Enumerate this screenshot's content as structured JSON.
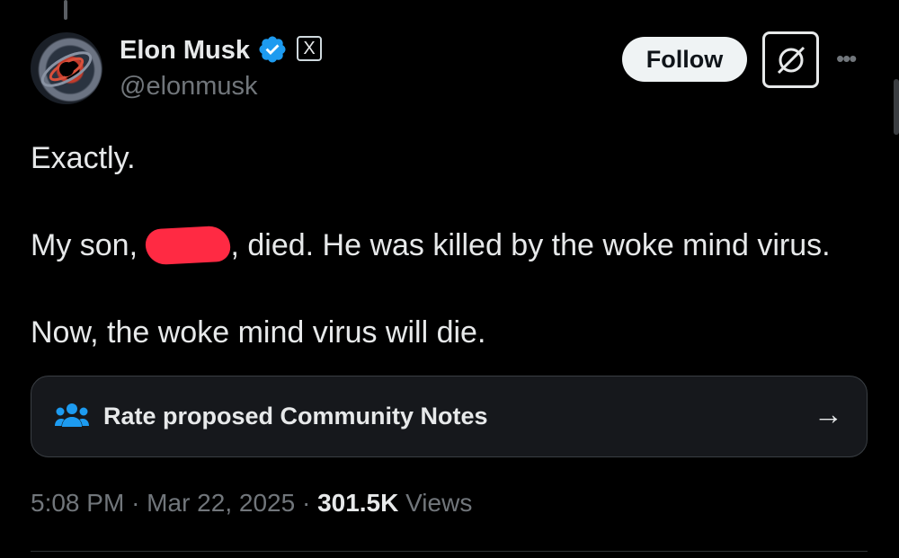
{
  "author": {
    "name": "Elon Musk",
    "handle": "@elonmusk",
    "verified": true,
    "affiliation_badge": "X"
  },
  "actions": {
    "follow_label": "Follow",
    "grok_icon": "grok-icon",
    "more_icon": "more-icon"
  },
  "tweet": {
    "line1": "Exactly.",
    "line2_before": "My son, ",
    "line2_after": ", died. He was killed by the woke mind virus.",
    "line3": "Now, the woke mind virus will die."
  },
  "community_notes": {
    "label": "Rate proposed Community Notes",
    "icon": "people-icon",
    "arrow": "→"
  },
  "meta": {
    "time": "5:08 PM",
    "sep1": "·",
    "date": "Mar 22, 2025",
    "sep2": "·",
    "views_count": "301.5K",
    "views_label": "Views"
  },
  "colors": {
    "background": "#000000",
    "text": "#e7e9ea",
    "secondary_text": "#71767b",
    "verified_blue": "#1d9bf0",
    "redaction": "#ff2a43",
    "notes_icon": "#1d9bf0"
  }
}
